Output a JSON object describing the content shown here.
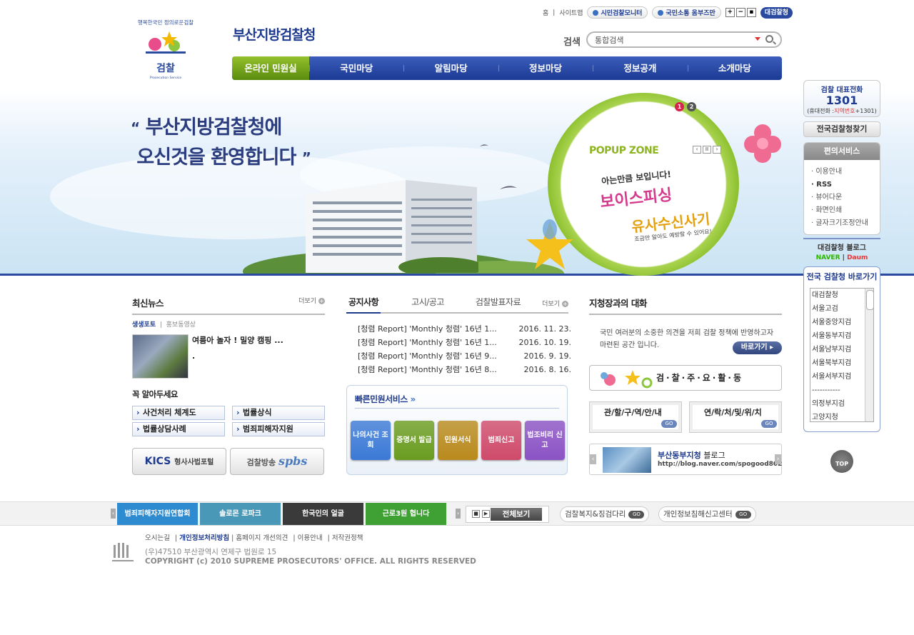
{
  "header": {
    "site_name": "부산지방검찰청",
    "logo_text": "검찰",
    "logo_subtext": "Prosecution Service",
    "logo_slogan": "행복한국민 정의로운검찰",
    "util": {
      "home": "홈",
      "sitemap": "사이트맵",
      "monitor": "시민검찰모니터",
      "communication": "국민소통 옴부즈만",
      "zoom_in": "+",
      "zoom_out": "−",
      "zoom_reset": "▪",
      "supreme": "대검찰청"
    },
    "search": {
      "label": "검색",
      "value": "통합검색"
    },
    "gnb": [
      "온라인 민원실",
      "국민마당",
      "알림마당",
      "정보마당",
      "정보공개",
      "소개마당"
    ]
  },
  "visual": {
    "welcome_line1": "부산지방검찰청에",
    "welcome_line2": "오신것을 환영합니다",
    "quote_open": "“",
    "quote_close": "”",
    "popup": {
      "title": "POPUP ZONE",
      "dots": [
        "1",
        "2"
      ],
      "ctrl": [
        "‹",
        "II",
        "›"
      ],
      "line1": "아는만큼 보입니다!",
      "line2": "보이스피싱",
      "line3": "유사수신사기",
      "line4": "조금만 알아도 예방할 수 있어요!"
    }
  },
  "quick": {
    "call_title": "검찰 대표전화",
    "call_number": "1301",
    "call_note_prefix": "(휴대전화 :",
    "call_note_em": "지역번호",
    "call_note_suffix": "+1301)",
    "find": "전국검찰청찾기",
    "convenience_title": "편의서비스",
    "convenience": [
      "· 이용안내",
      "· RSS",
      "· 뷰어다운",
      "· 화면인쇄",
      "· 글자크기조정안내"
    ],
    "blog_title": "대검찰청 블로그",
    "blog_naver": "NAVER",
    "blog_daum": "Daum",
    "shortcut_title": "전국 검찰청 바로가기",
    "shortcut_list": [
      "대검찰청",
      "서울고검",
      "서울중앙지검",
      "서울동부지검",
      "서울남부지검",
      "서울북부지검",
      "서울서부지검",
      "-----------",
      "의정부지검",
      "고양지청"
    ],
    "top": "TOP"
  },
  "news": {
    "title": "최신뉴스",
    "more": "더보기",
    "tab_on": "생생포토",
    "tab_sep": "|",
    "tab_off": "홍보동영상",
    "item_title": "여름아 놀자 ! 밀양 캠핑 ...",
    "item_desc": "."
  },
  "know": {
    "title": "꼭 알아두세요",
    "items": [
      "사건처리 체계도",
      "법률상식",
      "법률상담사례",
      "범죄피해자지원"
    ]
  },
  "portals": {
    "kics_logo": "KICS",
    "kics_label": "형사사법포털",
    "spbs_label": "검찰방송",
    "spbs_logo": "spbs"
  },
  "notice": {
    "tabs": [
      "공지사항",
      "고시/공고",
      "검찰발표자료"
    ],
    "more": "더보기",
    "items": [
      {
        "title": "[청렴 Report] 'Monthly 청렴' 16년 1...",
        "date": "2016. 11. 23."
      },
      {
        "title": "[청렴 Report] 'Monthly 청렴' 16년 1...",
        "date": "2016. 10. 19."
      },
      {
        "title": "[청렴 Report] 'Monthly 청렴' 16년 9...",
        "date": "2016. 9. 19."
      },
      {
        "title": "[청렴 Report] 'Monthly 청렴' 16년 8...",
        "date": "2016. 8. 16."
      }
    ]
  },
  "quick_service": {
    "title": "빠른민원서비스",
    "buttons": [
      {
        "label": "나의사건 조회",
        "color": "#3b79d6"
      },
      {
        "label": "증명서 발급",
        "color": "#6a9c1f"
      },
      {
        "label": "민원서식",
        "color": "#b98a1c"
      },
      {
        "label": "범죄신고",
        "color": "#cf4a6a"
      },
      {
        "label": "법조비리 신고",
        "color": "#8b52c4"
      }
    ]
  },
  "talk": {
    "title": "지청장과의 대화",
    "desc": "국민 여러분의 소중한 의견을 저희 검찰 정책에 반영하고자 마련된 공간 입니다.",
    "go": "바로가기"
  },
  "activity": "검·찰·주·요·활·동",
  "boxes": {
    "jurisdiction": "관/할/구/역/안/내",
    "contact": "연/락/처/및/위/치",
    "go": "GO"
  },
  "blog_banner": {
    "name": "부산동부지청",
    "suffix": " 블로그",
    "url": "http://blog.naver.com/spogood802"
  },
  "strip": {
    "banners": [
      {
        "text": "범죄피해자지원연합회",
        "color": "#2f8bd0"
      },
      {
        "text": "솔로몬 로파크",
        "color": "#4a98b8"
      },
      {
        "text": "한국인의 얼굴",
        "color": "#3a3a3a"
      },
      {
        "text": "근로3원 협니다",
        "color": "#3fa033"
      }
    ],
    "all": "전체보기",
    "welfare": "검찰복지&징검다리",
    "privacy": "개인정보침해신고센터",
    "go": "GO"
  },
  "footer": {
    "links": [
      "오시는길",
      "개인정보처리방침",
      "홈페이지 개선의견",
      "이용안내",
      "저작권정책"
    ],
    "address": "(우)47510 부산광역시 연제구 법원로 15",
    "copyright": "COPYRIGHT (c) 2010 SUPREME PROSECUTORS' OFFICE. ALL RIGHTS RESERVED"
  }
}
